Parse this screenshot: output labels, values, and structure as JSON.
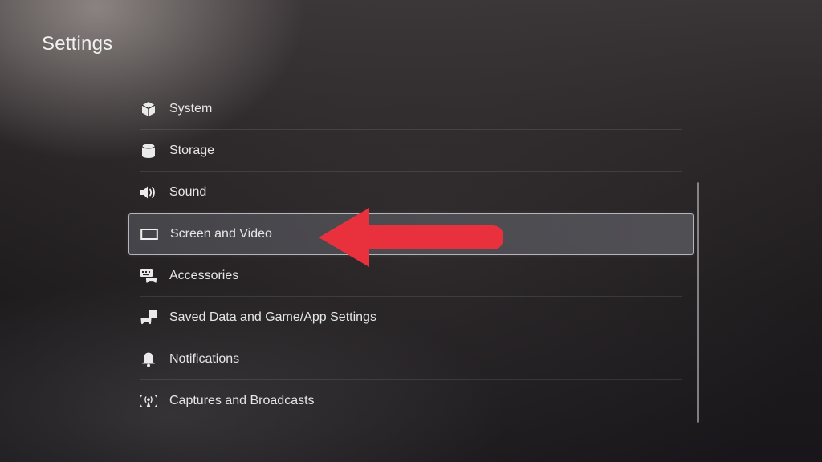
{
  "page": {
    "title": "Settings"
  },
  "menu": {
    "items": [
      {
        "label": "System",
        "icon": "system-cube-icon"
      },
      {
        "label": "Storage",
        "icon": "storage-cylinder-icon"
      },
      {
        "label": "Sound",
        "icon": "speaker-icon"
      },
      {
        "label": "Screen and Video",
        "icon": "screen-icon",
        "selected": true
      },
      {
        "label": "Accessories",
        "icon": "keyboard-controller-icon"
      },
      {
        "label": "Saved Data and Game/App Settings",
        "icon": "saved-data-controller-icon"
      },
      {
        "label": "Notifications",
        "icon": "bell-icon"
      },
      {
        "label": "Captures and Broadcasts",
        "icon": "broadcast-icon"
      }
    ]
  },
  "annotation": {
    "arrow_color": "#e8313d"
  }
}
